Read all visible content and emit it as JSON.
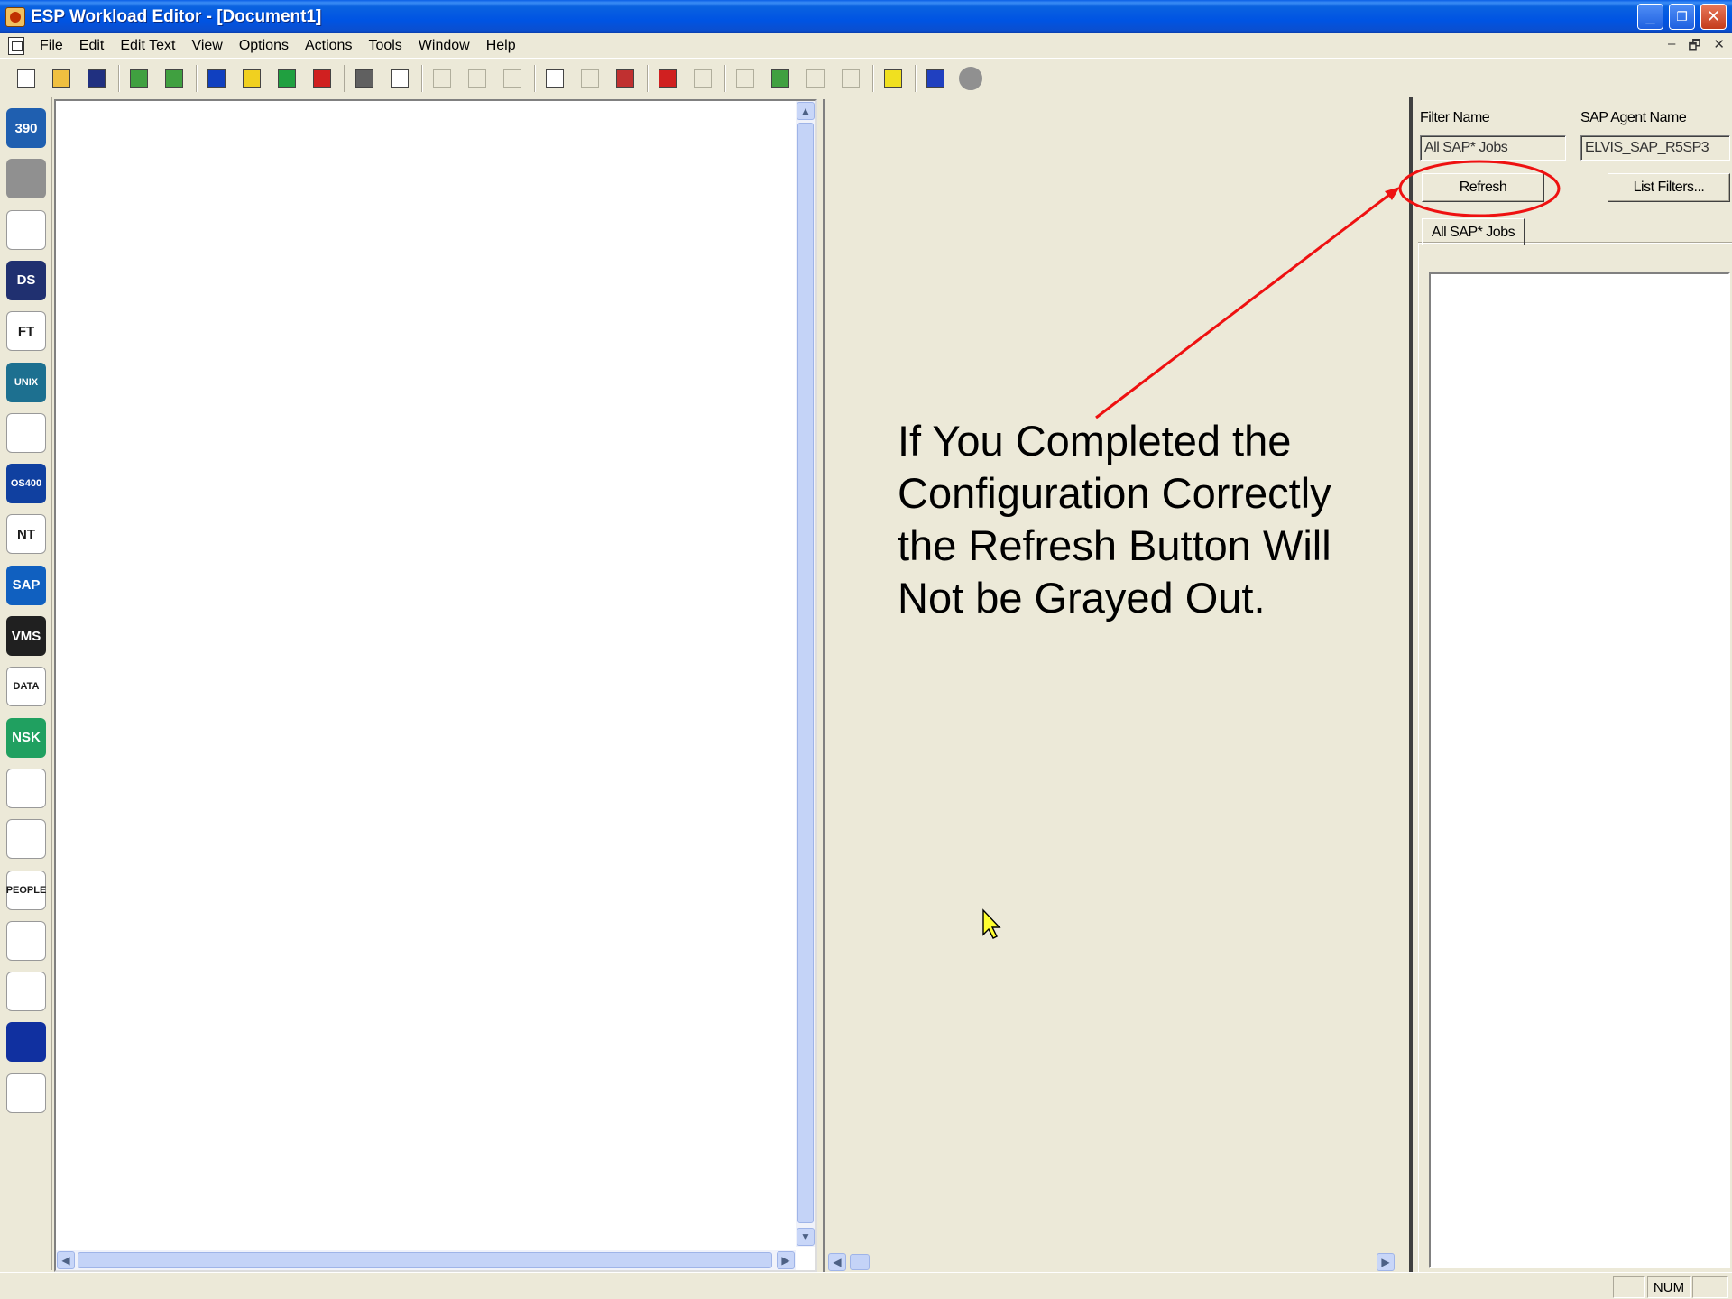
{
  "window": {
    "title": "ESP Workload Editor - [Document1]",
    "controls": {
      "minimize": "_",
      "restore": "❐",
      "close": "✕"
    }
  },
  "menu": {
    "items": [
      "File",
      "Edit",
      "Edit Text",
      "View",
      "Options",
      "Actions",
      "Tools",
      "Window",
      "Help"
    ],
    "mdi_controls": {
      "minimize": "–",
      "restore": "🗗",
      "close": "✕"
    }
  },
  "toolbar": {
    "buttons": [
      {
        "icon": "new-document-icon",
        "enabled": true
      },
      {
        "icon": "open-folder-icon",
        "enabled": true
      },
      {
        "icon": "save-icon",
        "enabled": true
      },
      {
        "icon": "upload-icon",
        "enabled": true
      },
      {
        "icon": "download-icon",
        "enabled": true
      },
      {
        "icon": "sap-icon",
        "enabled": true
      },
      {
        "icon": "event-icon",
        "enabled": true
      },
      {
        "icon": "green-job-icon",
        "enabled": true
      },
      {
        "icon": "red-job-icon",
        "enabled": true
      },
      {
        "icon": "print-icon",
        "enabled": true
      },
      {
        "icon": "print-preview-icon",
        "enabled": true
      },
      {
        "icon": "cut-icon",
        "enabled": false
      },
      {
        "icon": "copy-icon",
        "enabled": false
      },
      {
        "icon": "paste-icon",
        "enabled": false
      },
      {
        "icon": "select-icon",
        "enabled": true
      },
      {
        "icon": "link-icon",
        "enabled": false
      },
      {
        "icon": "grid-icon",
        "enabled": true
      },
      {
        "icon": "add-job-icon",
        "enabled": true
      },
      {
        "icon": "connect-icon",
        "enabled": false
      },
      {
        "icon": "properties-icon",
        "enabled": false
      },
      {
        "icon": "chart-icon",
        "enabled": true
      },
      {
        "icon": "align-left-icon",
        "enabled": false
      },
      {
        "icon": "align-right-icon",
        "enabled": false
      },
      {
        "icon": "highlight-icon",
        "enabled": true
      },
      {
        "icon": "agent-icon",
        "enabled": true
      },
      {
        "icon": "circle-icon",
        "enabled": false
      }
    ]
  },
  "palette": {
    "items": [
      {
        "name": "os390-icon",
        "text": "390",
        "color": "#1f5fb0"
      },
      {
        "name": "wrench-icon",
        "text": "",
        "color": "#909090"
      },
      {
        "name": "workflow-icon",
        "text": "",
        "color": "#ffffff"
      },
      {
        "name": "ds-icon",
        "text": "DS",
        "color": "#203070"
      },
      {
        "name": "ft-icon",
        "text": "FT",
        "color": "#ffffff"
      },
      {
        "name": "unix-icon",
        "text": "UNIX",
        "color": "#1d7090"
      },
      {
        "name": "linux-icon",
        "text": "",
        "color": "#ffffff"
      },
      {
        "name": "os400-icon",
        "text": "OS400",
        "color": "#1040a0"
      },
      {
        "name": "windows-nt-icon",
        "text": "NT",
        "color": "#ffffff"
      },
      {
        "name": "sap-icon",
        "text": "SAP",
        "color": "#1060c0"
      },
      {
        "name": "openvms-icon",
        "text": "VMS",
        "color": "#202020"
      },
      {
        "name": "data-icon",
        "text": "DATA",
        "color": "#ffffff"
      },
      {
        "name": "nsk-icon",
        "text": "NSK",
        "color": "#20a060"
      },
      {
        "name": "heart-icon",
        "text": "",
        "color": "#ffffff"
      },
      {
        "name": "checker-icon",
        "text": "",
        "color": "#ffffff"
      },
      {
        "name": "peoplesoft-icon",
        "text": "PEOPLE",
        "color": "#ffffff"
      },
      {
        "name": "globe-icon",
        "text": "",
        "color": "#ffffff"
      },
      {
        "name": "monitor-icon",
        "text": "",
        "color": "#ffffff"
      },
      {
        "name": "search-icon",
        "text": "",
        "color": "#1030a0"
      },
      {
        "name": "tree-icon",
        "text": "",
        "color": "#ffffff"
      }
    ]
  },
  "annotation": {
    "lines": [
      "If You Completed the",
      "Configuration Correctly",
      "the Refresh Button Will",
      "Not be Grayed Out."
    ],
    "color": "#ee1111"
  },
  "sap_panel": {
    "filter_name_label": "Filter Name",
    "agent_name_label": "SAP Agent Name",
    "filter_name_value": "All SAP* Jobs",
    "agent_name_value": "ELVIS_SAP_R5SP3",
    "refresh_label": "Refresh",
    "list_filters_label": "List Filters...",
    "tab_label": "All SAP* Jobs"
  },
  "statusbar": {
    "num": "NUM"
  }
}
